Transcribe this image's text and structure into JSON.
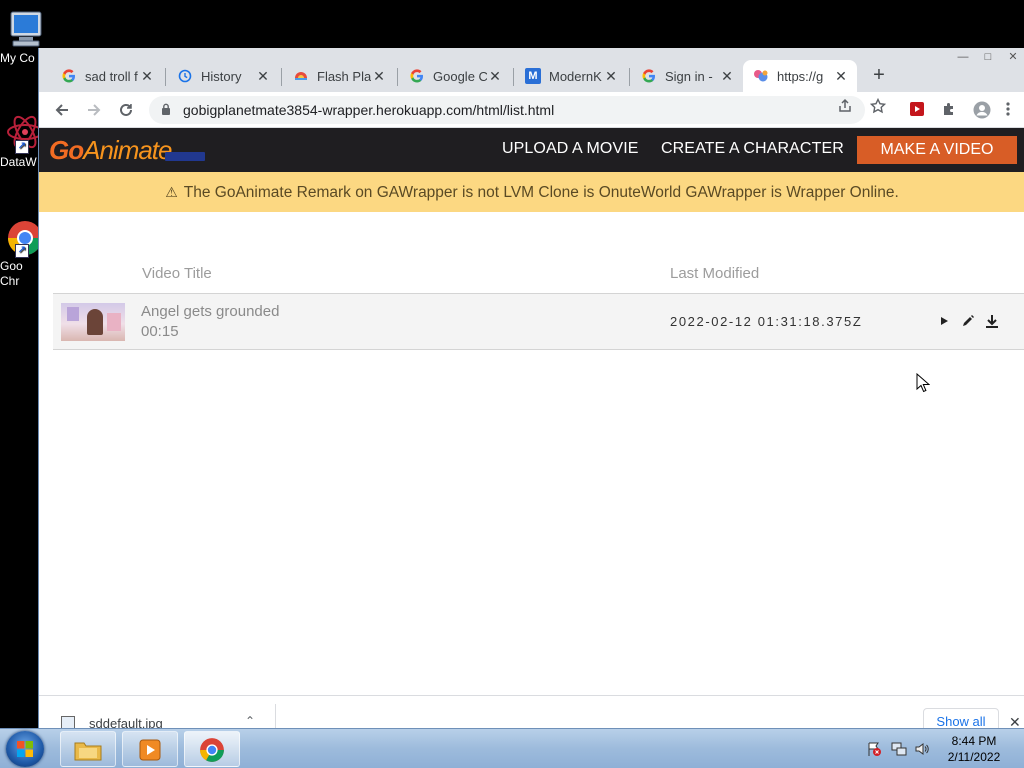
{
  "desktop": {
    "icons": [
      {
        "label": "My Co"
      },
      {
        "label": "DataW"
      },
      {
        "label": "Goo"
      },
      {
        "label": "Chr"
      }
    ]
  },
  "browser": {
    "window_controls": {
      "minimize": "—",
      "maximize": "□",
      "close": "✕"
    },
    "tabs": [
      {
        "title": "sad troll f",
        "icon": "google-icon"
      },
      {
        "title": "History",
        "icon": "history-icon"
      },
      {
        "title": "Flash Play",
        "icon": "flash-icon"
      },
      {
        "title": "Google C",
        "icon": "google-icon"
      },
      {
        "title": "ModernK",
        "icon": "modernk-icon"
      },
      {
        "title": "Sign in - ",
        "icon": "google-icon"
      },
      {
        "title": "https://g",
        "icon": "wrapper-icon",
        "active": true
      }
    ],
    "new_tab": "+",
    "url": "gobigplanetmate3854-wrapper.herokuapp.com/html/list.html"
  },
  "site": {
    "logo": {
      "go": "Go",
      "animate": "Animate"
    },
    "nav": {
      "upload": "UPLOAD A MOVIE",
      "create": "CREATE A CHARACTER",
      "make": "MAKE A VIDEO"
    },
    "notice": "The GoAnimate Remark on GAWrapper is not LVM Clone is OnuteWorld GAWrapper is Wrapper Online.",
    "table": {
      "headers": {
        "title": "Video Title",
        "modified": "Last Modified"
      },
      "rows": [
        {
          "title": "Angel gets grounded",
          "duration": "00:15",
          "modified": "2022-02-12 01:31:18.375Z"
        }
      ]
    }
  },
  "downloads": {
    "file": "sddefault.jpg",
    "show_all": "Show all"
  },
  "taskbar": {
    "time": "8:44 PM",
    "date": "2/11/2022"
  },
  "colors": {
    "accent": "#d85d26",
    "notice_bg": "#fcd882",
    "header_bg": "#1f1e21"
  }
}
